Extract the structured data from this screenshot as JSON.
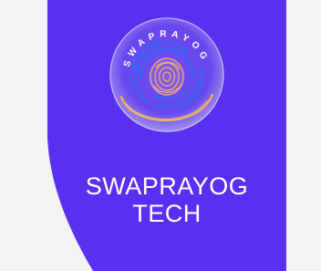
{
  "colors": {
    "card_background": "#5b2ff0",
    "page_background": "#f3f3f5",
    "logo_disc": "#cfc8ee",
    "logo_circuit": "#2f6cf2",
    "logo_arc": "#f0b45a",
    "logo_fingerprint": "#e9a38a",
    "text": "#ffffff"
  },
  "logo": {
    "ring_text": "SWAPRAYOG",
    "icon": "fingerprint-circuit-icon"
  },
  "brand": {
    "line1": "SWAPRAYOG",
    "line2": "TECH"
  }
}
